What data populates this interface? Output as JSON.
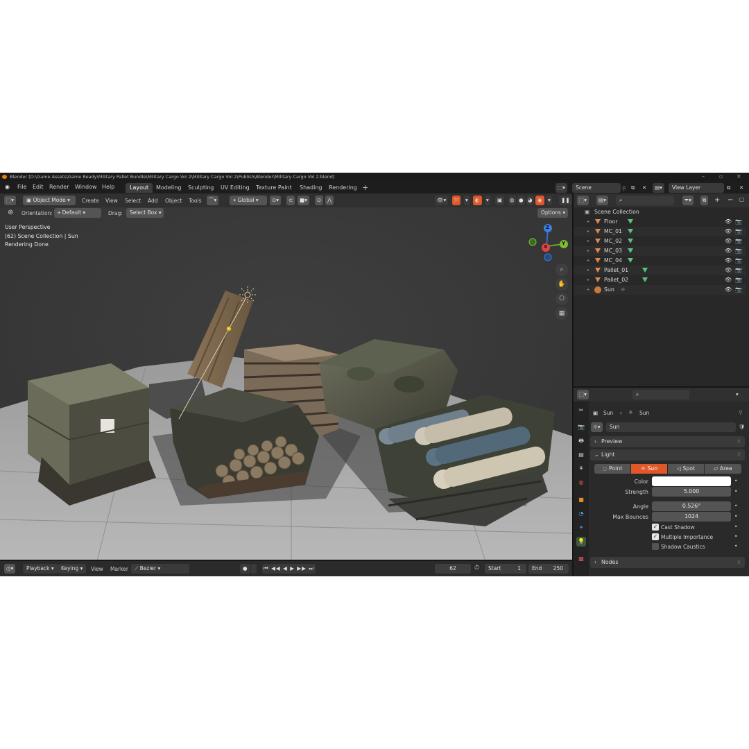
{
  "window": {
    "title": "Blender [D:\\Game Assets\\Game Ready\\Military Pallet Bundle\\Military Cargo Vol 2\\Military Cargo Vol 2\\Publish\\Blender\\Military Cargo Vol 2.blend]"
  },
  "menu": [
    "File",
    "Edit",
    "Render",
    "Window",
    "Help"
  ],
  "workspaces": [
    "Layout",
    "Modeling",
    "Sculpting",
    "UV Editing",
    "Texture Paint",
    "Shading",
    "Rendering"
  ],
  "active_workspace": "Layout",
  "header": {
    "mode": "Object Mode",
    "menus": [
      "Create",
      "View",
      "Select",
      "Add",
      "Object",
      "Tools"
    ],
    "transform_orientation": "Global",
    "orientation_label": "Orientation:",
    "orientation_value": "Default",
    "drag_label": "Drag:",
    "drag_value": "Select Box",
    "options": "Options"
  },
  "viewport": {
    "line1": "User Perspective",
    "line2": "(62) Scene Collection | Sun",
    "line3": "Rendering Done",
    "gizmo": {
      "x": "X",
      "y": "Y",
      "z": "Z"
    }
  },
  "timeline": {
    "playback": "Playback",
    "keying": "Keying",
    "view": "View",
    "marker": "Marker",
    "interpolation": "Bezier",
    "current_frame": "62",
    "start_label": "Start",
    "start": "1",
    "end_label": "End",
    "end": "250"
  },
  "top_right": {
    "scene": "Scene",
    "view_layer": "View Layer"
  },
  "outliner": {
    "root": "Scene Collection",
    "items": [
      {
        "name": "Floor",
        "type": "mesh"
      },
      {
        "name": "MC_01",
        "type": "mesh"
      },
      {
        "name": "MC_02",
        "type": "mesh"
      },
      {
        "name": "MC_03",
        "type": "mesh"
      },
      {
        "name": "MC_04",
        "type": "mesh"
      },
      {
        "name": "Pallet_01",
        "type": "mesh"
      },
      {
        "name": "Pallet_02",
        "type": "mesh"
      },
      {
        "name": "Sun",
        "type": "light"
      }
    ]
  },
  "properties": {
    "breadcrumb_object": "Sun",
    "breadcrumb_data": "Sun",
    "datablock": "Sun",
    "panels": {
      "preview": "Preview",
      "light": "Light",
      "nodes": "Nodes"
    },
    "light_types": [
      "Point",
      "Sun",
      "Spot",
      "Area"
    ],
    "active_light_type": "Sun",
    "color_label": "Color",
    "color_value": "#ffffff",
    "strength_label": "Strength",
    "strength": "5.000",
    "angle_label": "Angle",
    "angle": "0.526°",
    "max_bounces_label": "Max Bounces",
    "max_bounces": "1024",
    "cast_shadow": {
      "label": "Cast Shadow",
      "checked": true
    },
    "multiple_importance": {
      "label": "Multiple Importance",
      "checked": true
    },
    "shadow_caustics": {
      "label": "Shadow Caustics",
      "checked": false
    }
  },
  "colors": {
    "accent": "#e0582a",
    "active_tab": "#3d3d3d",
    "mesh_icon": "#59c27e",
    "object_icon": "#e0894b"
  }
}
